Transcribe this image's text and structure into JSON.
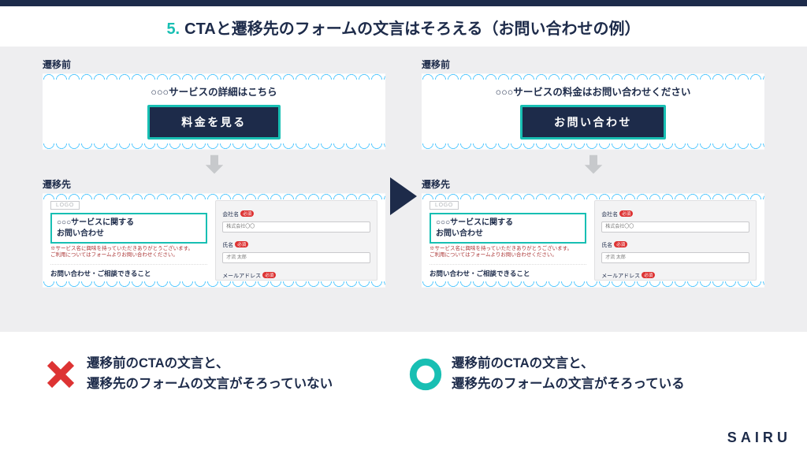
{
  "header": {
    "num": "5.",
    "title": "CTAと遷移先のフォームの文言はそろえる（お問い合わせの例）"
  },
  "labels": {
    "before": "遷移前",
    "after": "遷移先"
  },
  "left": {
    "cta_line": "○○○サービスの詳細はこちら",
    "cta_button": "料金を見る"
  },
  "right": {
    "cta_line": "○○○サービスの料金はお問い合わせください",
    "cta_button": "お問い合わせ"
  },
  "form": {
    "logo": "LOGO",
    "heading_l1": "○○○サービスに関する",
    "heading_l2": "お問い合わせ",
    "note": "※サービス名に興味を持っていただきありがとうございます。\nご利用についてはフォームよりお問い合わせください。",
    "subheading": "お問い合わせ・ご相談できること",
    "fields": {
      "company": {
        "label": "会社名",
        "req": "必須",
        "ph": "株式会社〇〇"
      },
      "name": {
        "label": "氏名",
        "req": "必須",
        "ph": "才流 太郎"
      },
      "email": {
        "label": "メールアドレス",
        "req": "必須"
      }
    }
  },
  "conclusion": {
    "bad": "遷移前のCTAの文言と、\n遷移先のフォームの文言がそろっていない",
    "good": "遷移前のCTAの文言と、\n遷移先のフォームの文言がそろっている"
  },
  "brand": "SAIRU"
}
